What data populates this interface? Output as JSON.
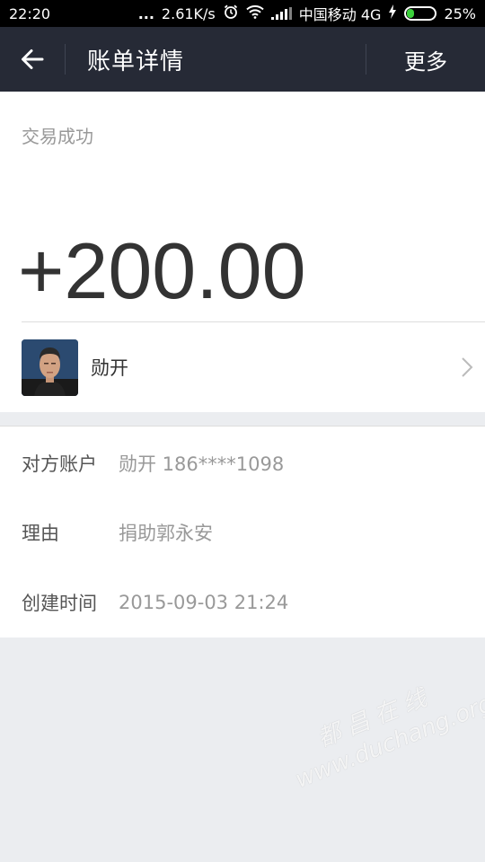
{
  "status_bar": {
    "time": "22:20",
    "dots": "...",
    "speed": "2.61K/s",
    "carrier": "中国移动 4G",
    "battery": "25%",
    "battery_level": 0.25,
    "icons": [
      "alarm-icon",
      "wifi-icon",
      "signal-icon",
      "charging-icon",
      "battery-icon"
    ]
  },
  "header": {
    "back_icon": "arrow-left-icon",
    "title": "账单详情",
    "more_label": "更多"
  },
  "transaction": {
    "status": "交易成功",
    "amount": "+200.00"
  },
  "counterparty": {
    "name": "勋开",
    "chevron_icon": "chevron-right-icon"
  },
  "details": [
    {
      "label": "对方账户",
      "value": "勋开 186****1098"
    },
    {
      "label": "理由",
      "value": "捐助郭永安"
    },
    {
      "label": "创建时间",
      "value": "2015-09-03 21:24"
    }
  ],
  "watermark": {
    "chinese": "都昌在线",
    "url": "www.duchang.org"
  },
  "colors": {
    "header_bg": "#262a36",
    "page_bg": "#ebedf0",
    "battery_green": "#3bd13b"
  }
}
